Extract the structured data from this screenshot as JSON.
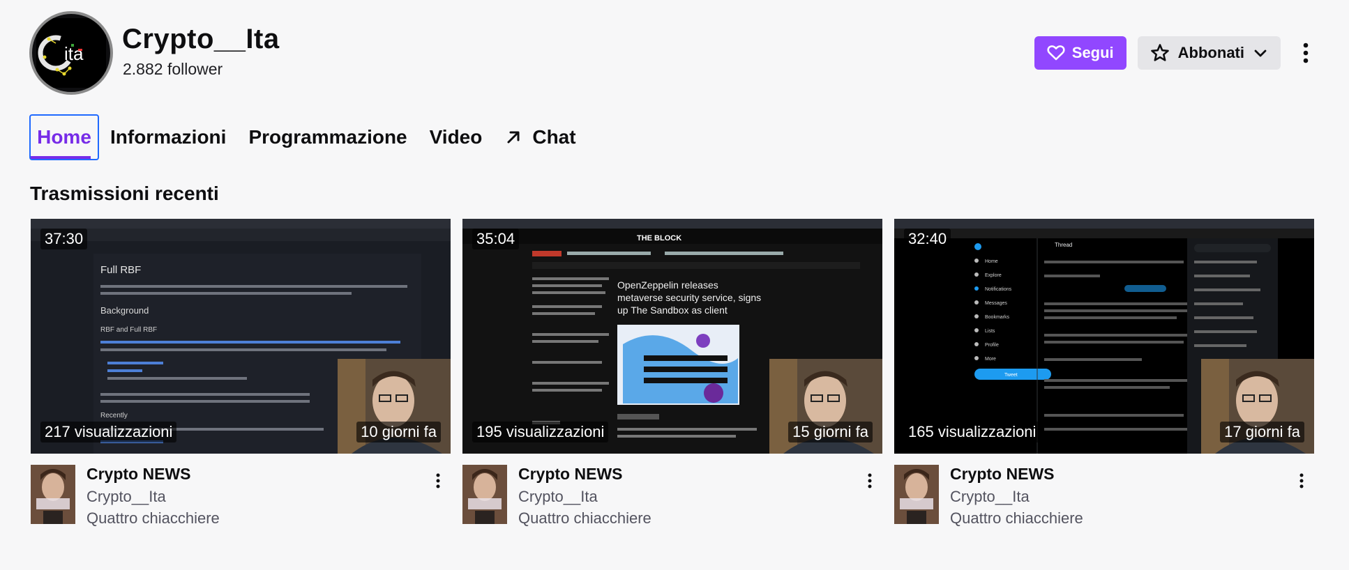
{
  "channel": {
    "name": "Crypto__Ita",
    "followers": "2.882 follower",
    "logo_text": "ita",
    "logo_letter": "C"
  },
  "actions": {
    "follow_label": "Segui",
    "subscribe_label": "Abbonati"
  },
  "tabs": [
    {
      "label": "Home",
      "active": true
    },
    {
      "label": "Informazioni"
    },
    {
      "label": "Programmazione"
    },
    {
      "label": "Video"
    },
    {
      "label": "Chat",
      "icon": "arrow-up-right-icon"
    }
  ],
  "section": {
    "title": "Trasmissioni recenti"
  },
  "videos": [
    {
      "duration": "37:30",
      "views": "217 visualizzazioni",
      "age": "10 giorni fa",
      "title": "Crypto NEWS",
      "channel": "Crypto__Ita",
      "category": "Quattro chiacchiere",
      "screen_heading": "Full RBF",
      "screen_sub1": "Background",
      "screen_sub2": "RBF and Full RBF",
      "screen_sub3": "Recently"
    },
    {
      "duration": "35:04",
      "views": "195 visualizzazioni",
      "age": "15 giorni fa",
      "title": "Crypto NEWS",
      "channel": "Crypto__Ita",
      "category": "Quattro chiacchiere",
      "screen_brand": "THE BLOCK",
      "screen_headline1": "OpenZeppelin releases",
      "screen_headline2": "metaverse security service, signs",
      "screen_headline3": "up The Sandbox as client"
    },
    {
      "duration": "32:40",
      "views": "165 visualizzazioni",
      "age": "17 giorni fa",
      "title": "Crypto NEWS",
      "channel": "Crypto__Ita",
      "category": "Quattro chiacchiere",
      "screen_nav": [
        "Home",
        "Explore",
        "Notifications",
        "Messages",
        "Bookmarks",
        "Lists",
        "Profile",
        "More"
      ],
      "screen_button": "Tweet",
      "screen_thread": "Thread"
    }
  ],
  "colors": {
    "accent": "#9147ff",
    "active_tab": "#772ce8",
    "focus": "#1f69ff"
  }
}
